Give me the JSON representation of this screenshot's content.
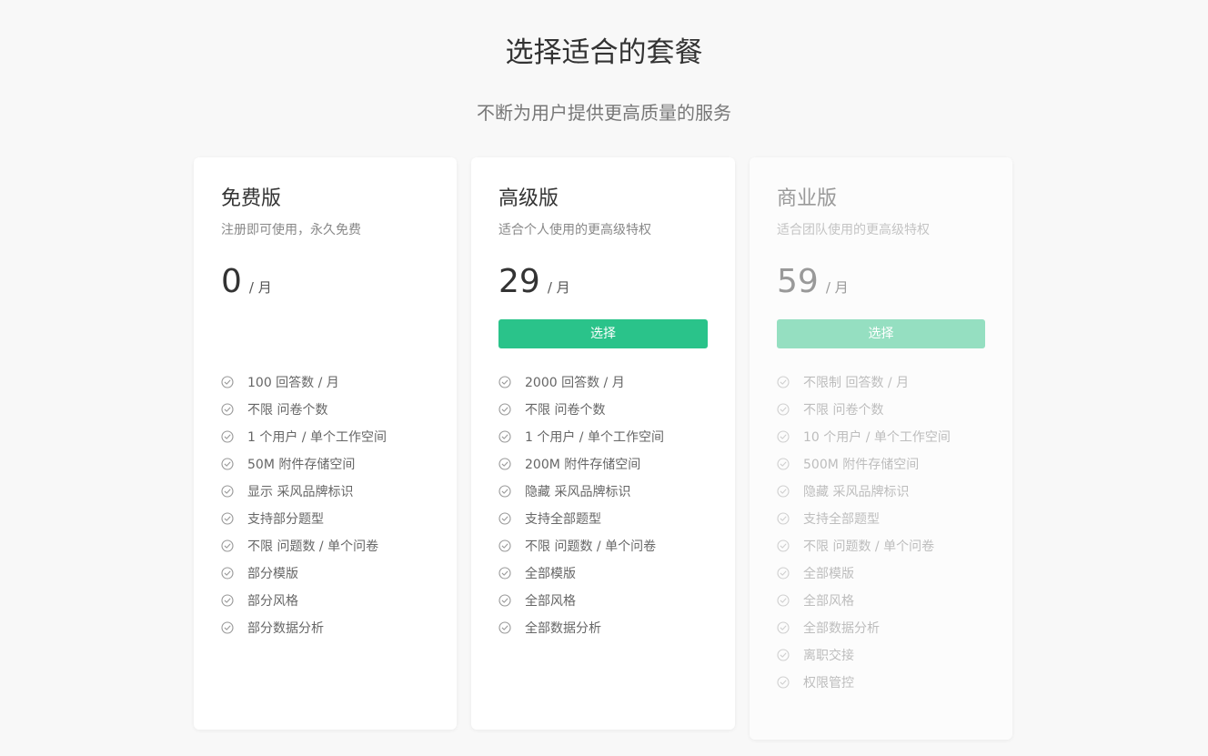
{
  "header": {
    "title": "选择适合的套餐",
    "subtitle": "不断为用户提供更高质量的服务"
  },
  "colors": {
    "accent": "#2ac38a",
    "accent_disabled": "#95dfc1",
    "background": "#f8f8f8",
    "check_icon": "#999999"
  },
  "plans": [
    {
      "name": "免费版",
      "description": "注册即可使用，永久免费",
      "price": "0",
      "unit": "/ 月",
      "icon": "check-circle-icon",
      "features": [
        "100 回答数 / 月",
        "不限 问卷个数",
        "1 个用户 / 单个工作空间",
        "50M 附件存储空间",
        "显示  采风品牌标识",
        "支持部分题型",
        "不限 问题数 / 单个问卷",
        "部分模版",
        "部分风格",
        "部分数据分析"
      ]
    },
    {
      "name": "高级版",
      "description": "适合个人使用的更高级特权",
      "price": "29",
      "unit": "/ 月",
      "button": "选择",
      "icon": "check-circle-icon",
      "features": [
        "2000 回答数 / 月",
        "不限 问卷个数",
        "1 个用户 / 单个工作空间",
        "200M 附件存储空间",
        "隐藏  采风品牌标识",
        "支持全部题型",
        "不限 问题数 / 单个问卷",
        "全部模版",
        "全部风格",
        "全部数据分析"
      ]
    },
    {
      "name": "商业版",
      "description": "适合团队使用的更高级特权",
      "price": "59",
      "unit": "/ 月",
      "button": "选择",
      "icon": "check-circle-icon",
      "features": [
        "不限制 回答数 / 月",
        "不限 问卷个数",
        "10 个用户 / 单个工作空间",
        "500M 附件存储空间",
        "隐藏  采风品牌标识",
        "支持全部题型",
        "不限 问题数 / 单个问卷",
        "全部模版",
        "全部风格",
        "全部数据分析",
        "离职交接",
        "权限管控"
      ]
    }
  ]
}
